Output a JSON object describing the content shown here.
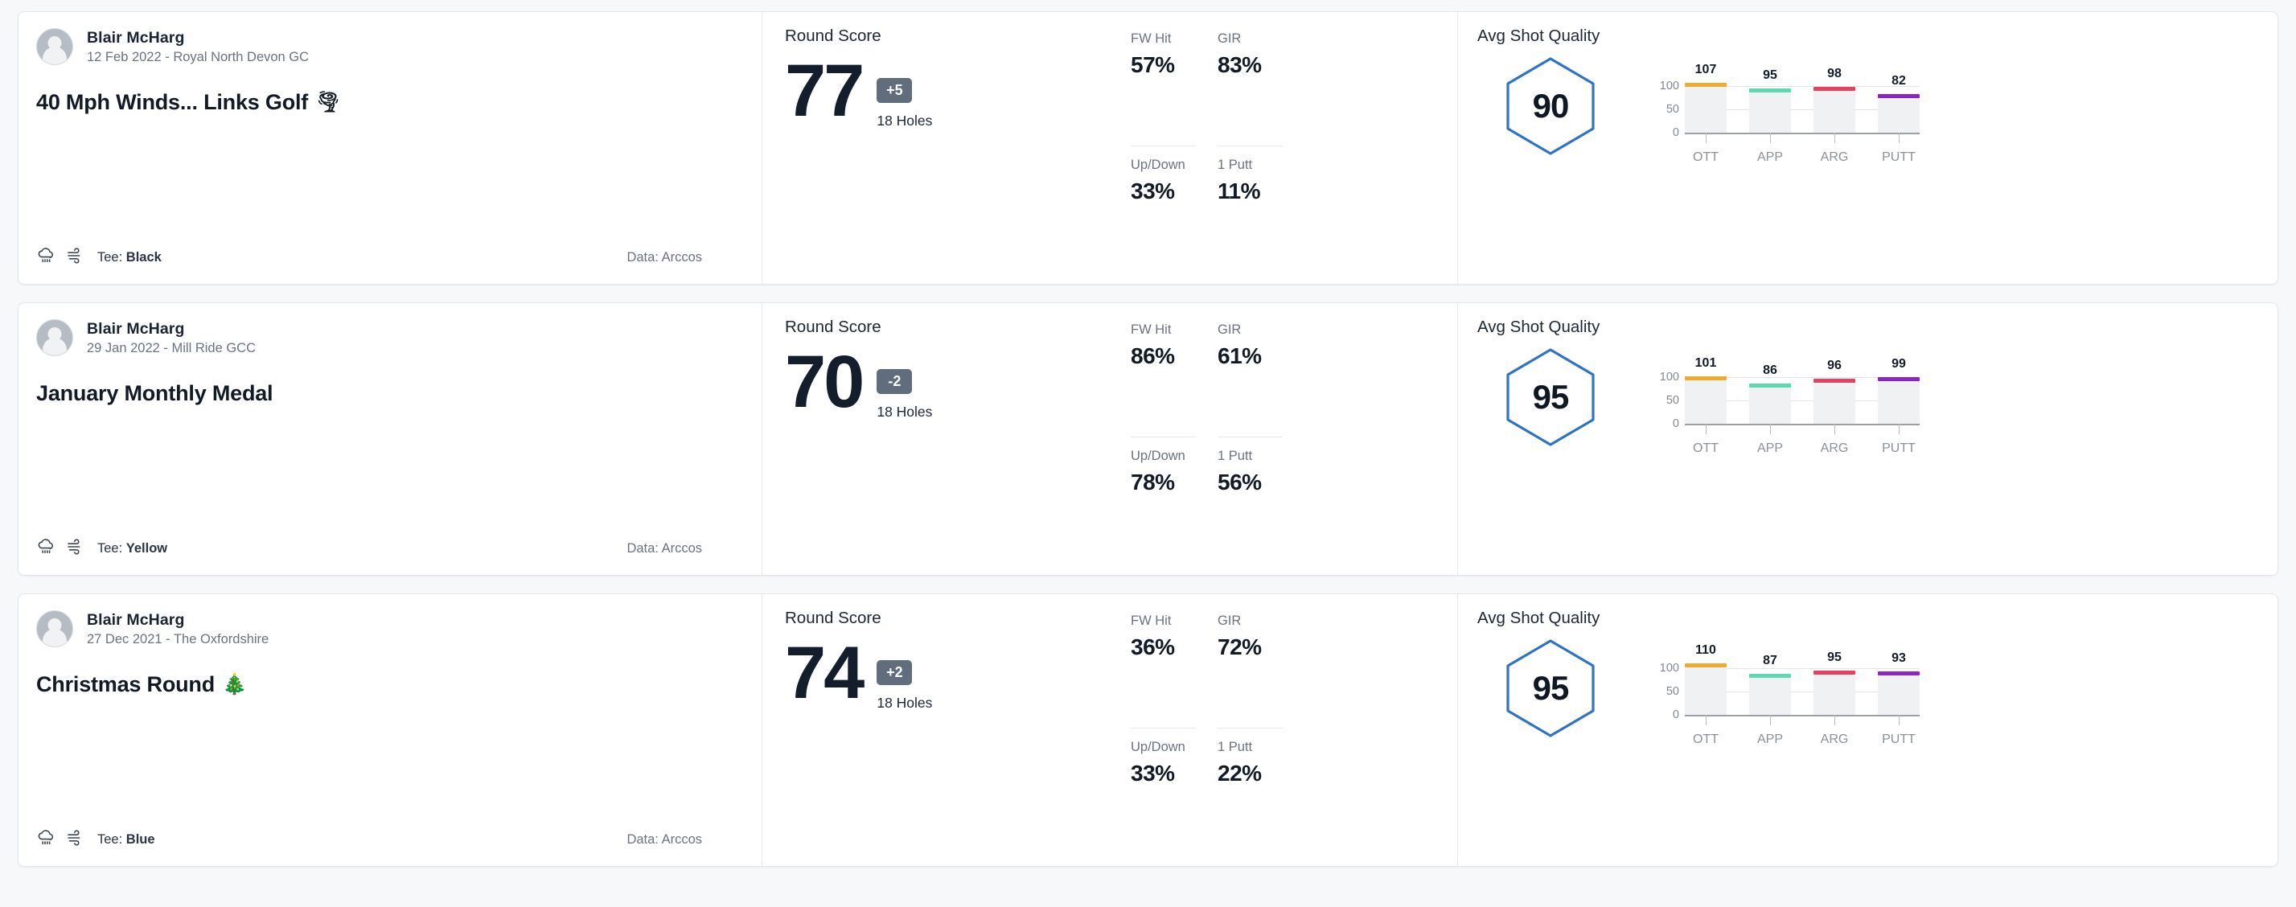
{
  "theme": {
    "page_bg": "#f7f8fa",
    "card_bg": "#ffffff",
    "accent_hex": "#2f73c4",
    "to_par_badge_hex": "#616c7c",
    "bar_track_hex": "#f0f1f2"
  },
  "chart_common": {
    "y_ticks": [
      "100",
      "50",
      "0"
    ],
    "y_values": [
      100,
      50,
      0
    ],
    "categories": [
      "OTT",
      "APP",
      "ARG",
      "PUTT"
    ],
    "series_colors": [
      "#efab2e",
      "#5fd8b2",
      "#e8405f",
      "#8e24c4"
    ],
    "ymax": 120
  },
  "labels": {
    "round_score": "Round Score",
    "holes": "18 Holes",
    "avg_shot_quality": "Avg Shot Quality",
    "fw_hit": "FW Hit",
    "gir": "GIR",
    "up_down": "Up/Down",
    "one_putt": "1 Putt",
    "tee_prefix": "Tee: ",
    "data_source": "Data: Arccos"
  },
  "rounds": [
    {
      "player": "Blair McHarg",
      "meta": "12 Feb 2022 - Royal North Devon GC",
      "title": "40 Mph Winds... Links Golf",
      "title_emoji": "🌪",
      "tee": "Black",
      "data_source": "Data: Arccos",
      "score": "77",
      "to_par": "+5",
      "holes": "18 Holes",
      "stats": {
        "fw_hit": "57%",
        "gir": "83%",
        "up_down": "33%",
        "one_putt": "11%"
      },
      "shot_quality": "90",
      "chart_data": {
        "type": "bar",
        "title": "Avg Shot Quality",
        "categories": [
          "OTT",
          "APP",
          "ARG",
          "PUTT"
        ],
        "values": [
          107,
          95,
          98,
          82
        ],
        "labels": [
          "107",
          "95",
          "98",
          "82"
        ],
        "colors": [
          "#efab2e",
          "#5fd8b2",
          "#e8405f",
          "#8e24c4"
        ],
        "ylim": [
          0,
          120
        ],
        "yticks": [
          0,
          50,
          100
        ],
        "xlabel": "",
        "ylabel": "",
        "grid": true,
        "legend": "none"
      }
    },
    {
      "player": "Blair McHarg",
      "meta": "29 Jan 2022 - Mill Ride GCC",
      "title": "January Monthly Medal",
      "title_emoji": "",
      "tee": "Yellow",
      "data_source": "Data: Arccos",
      "score": "70",
      "to_par": "-2",
      "holes": "18 Holes",
      "stats": {
        "fw_hit": "86%",
        "gir": "61%",
        "up_down": "78%",
        "one_putt": "56%"
      },
      "shot_quality": "95",
      "chart_data": {
        "type": "bar",
        "title": "Avg Shot Quality",
        "categories": [
          "OTT",
          "APP",
          "ARG",
          "PUTT"
        ],
        "values": [
          101,
          86,
          96,
          99
        ],
        "labels": [
          "101",
          "86",
          "96",
          "99"
        ],
        "colors": [
          "#efab2e",
          "#5fd8b2",
          "#e8405f",
          "#8e24c4"
        ],
        "ylim": [
          0,
          120
        ],
        "yticks": [
          0,
          50,
          100
        ],
        "xlabel": "",
        "ylabel": "",
        "grid": true,
        "legend": "none"
      }
    },
    {
      "player": "Blair McHarg",
      "meta": "27 Dec 2021 - The Oxfordshire",
      "title": "Christmas Round",
      "title_emoji": "🎄",
      "tee": "Blue",
      "data_source": "Data: Arccos",
      "score": "74",
      "to_par": "+2",
      "holes": "18 Holes",
      "stats": {
        "fw_hit": "36%",
        "gir": "72%",
        "up_down": "33%",
        "one_putt": "22%"
      },
      "shot_quality": "95",
      "chart_data": {
        "type": "bar",
        "title": "Avg Shot Quality",
        "categories": [
          "OTT",
          "APP",
          "ARG",
          "PUTT"
        ],
        "values": [
          110,
          87,
          95,
          93
        ],
        "labels": [
          "110",
          "87",
          "95",
          "93"
        ],
        "colors": [
          "#efab2e",
          "#5fd8b2",
          "#e8405f",
          "#8e24c4"
        ],
        "ylim": [
          0,
          120
        ],
        "yticks": [
          0,
          50,
          100
        ],
        "xlabel": "",
        "ylabel": "",
        "grid": true,
        "legend": "none"
      }
    }
  ]
}
